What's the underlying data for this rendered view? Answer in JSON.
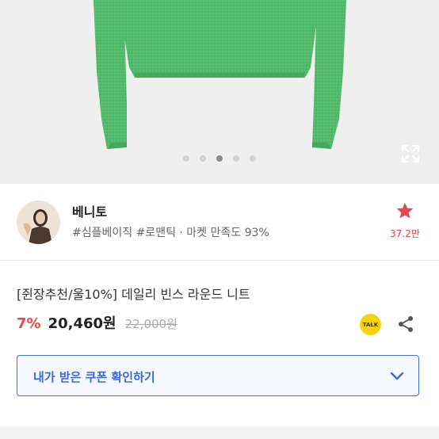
{
  "gallery": {
    "image_alt": "green knit sweater",
    "dots_count": 5,
    "active_dot": 3,
    "expand_icon": "expand-icon"
  },
  "seller": {
    "name": "베니토",
    "tags": "#심플베이직 #로맨틱 · 마켓 만족도 93%",
    "favorite_icon": "star-icon",
    "favorite_count": "37.2만"
  },
  "product": {
    "title": "[쥔장추천/울10%] 데일리 빈스 라운드 니트",
    "discount": "7%",
    "price": "20,460원",
    "original_price": "22,000원",
    "talk_label": "TALK"
  },
  "coupon": {
    "label": "내가 받은 쿠폰 확인하기",
    "chevron_icon": "chevron-down-icon"
  },
  "colors": {
    "accent_red": "#e8454f",
    "accent_blue": "#3a68d6",
    "kakao_yellow": "#f5d312",
    "sweater_green": "#52ba6a"
  }
}
